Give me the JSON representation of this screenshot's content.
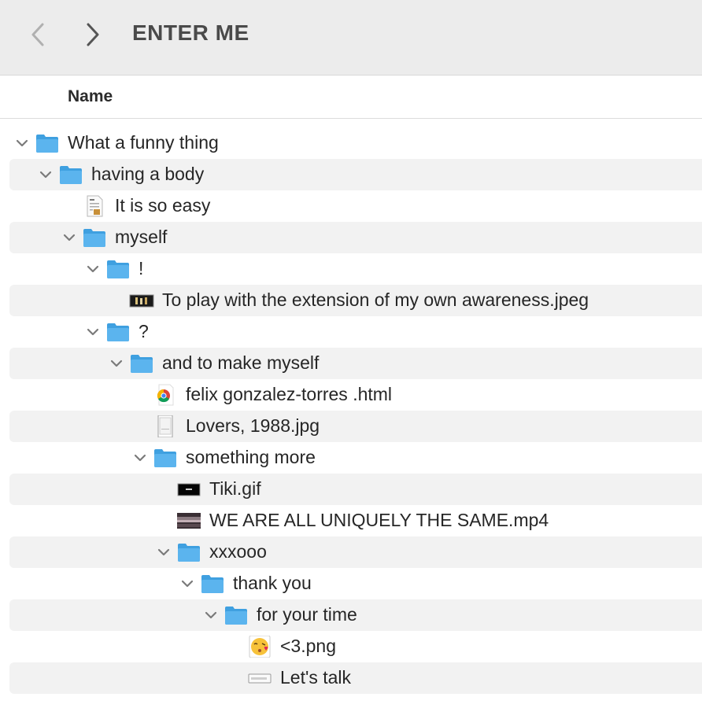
{
  "window": {
    "title": "ENTER ME"
  },
  "nav": {
    "back_icon": "chevron-left-icon",
    "forward_icon": "chevron-right-icon"
  },
  "columns": {
    "name": "Name"
  },
  "colors": {
    "folder": "#5bb4ee",
    "folder_tab": "#3fa0e0",
    "row_stripe": "#f2f2f2",
    "chevron": "#7a7a7a"
  },
  "items": [
    {
      "label": "What a funny thing",
      "kind": "folder",
      "expanded": true
    },
    {
      "label": "having a body",
      "kind": "folder",
      "expanded": true
    },
    {
      "label": "It is so easy",
      "kind": "document"
    },
    {
      "label": "myself",
      "kind": "folder",
      "expanded": true
    },
    {
      "label": "!",
      "kind": "folder",
      "expanded": true
    },
    {
      "label": "To play with the extension of my own awareness.jpeg",
      "kind": "image"
    },
    {
      "label": "?",
      "kind": "folder",
      "expanded": true
    },
    {
      "label": "and to make myself",
      "kind": "folder",
      "expanded": true
    },
    {
      "label": "felix gonzalez-torres .html",
      "kind": "html"
    },
    {
      "label": "Lovers, 1988.jpg",
      "kind": "image-blank"
    },
    {
      "label": "something more",
      "kind": "folder",
      "expanded": true
    },
    {
      "label": "Tiki.gif",
      "kind": "gif"
    },
    {
      "label": "WE ARE ALL UNIQUELY THE SAME.mp4",
      "kind": "video"
    },
    {
      "label": "xxxooo",
      "kind": "folder",
      "expanded": true
    },
    {
      "label": "thank you",
      "kind": "folder",
      "expanded": true
    },
    {
      "label": "for your time",
      "kind": "folder",
      "expanded": true
    },
    {
      "label": "<3.png",
      "kind": "emoji-image"
    },
    {
      "label": "Let's talk",
      "kind": "file"
    }
  ]
}
